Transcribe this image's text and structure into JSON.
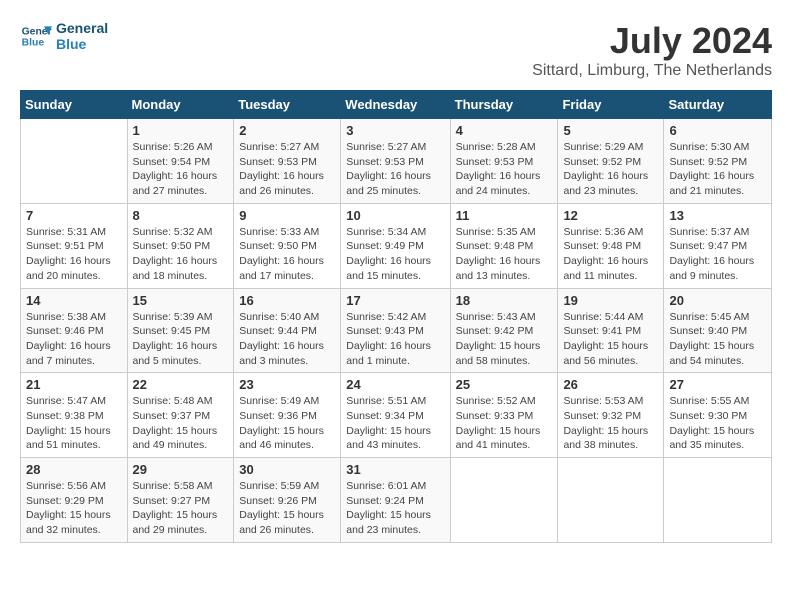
{
  "logo": {
    "line1": "General",
    "line2": "Blue"
  },
  "title": "July 2024",
  "location": "Sittard, Limburg, The Netherlands",
  "days_of_week": [
    "Sunday",
    "Monday",
    "Tuesday",
    "Wednesday",
    "Thursday",
    "Friday",
    "Saturday"
  ],
  "weeks": [
    [
      {
        "day": "",
        "info": ""
      },
      {
        "day": "1",
        "info": "Sunrise: 5:26 AM\nSunset: 9:54 PM\nDaylight: 16 hours\nand 27 minutes."
      },
      {
        "day": "2",
        "info": "Sunrise: 5:27 AM\nSunset: 9:53 PM\nDaylight: 16 hours\nand 26 minutes."
      },
      {
        "day": "3",
        "info": "Sunrise: 5:27 AM\nSunset: 9:53 PM\nDaylight: 16 hours\nand 25 minutes."
      },
      {
        "day": "4",
        "info": "Sunrise: 5:28 AM\nSunset: 9:53 PM\nDaylight: 16 hours\nand 24 minutes."
      },
      {
        "day": "5",
        "info": "Sunrise: 5:29 AM\nSunset: 9:52 PM\nDaylight: 16 hours\nand 23 minutes."
      },
      {
        "day": "6",
        "info": "Sunrise: 5:30 AM\nSunset: 9:52 PM\nDaylight: 16 hours\nand 21 minutes."
      }
    ],
    [
      {
        "day": "7",
        "info": "Sunrise: 5:31 AM\nSunset: 9:51 PM\nDaylight: 16 hours\nand 20 minutes."
      },
      {
        "day": "8",
        "info": "Sunrise: 5:32 AM\nSunset: 9:50 PM\nDaylight: 16 hours\nand 18 minutes."
      },
      {
        "day": "9",
        "info": "Sunrise: 5:33 AM\nSunset: 9:50 PM\nDaylight: 16 hours\nand 17 minutes."
      },
      {
        "day": "10",
        "info": "Sunrise: 5:34 AM\nSunset: 9:49 PM\nDaylight: 16 hours\nand 15 minutes."
      },
      {
        "day": "11",
        "info": "Sunrise: 5:35 AM\nSunset: 9:48 PM\nDaylight: 16 hours\nand 13 minutes."
      },
      {
        "day": "12",
        "info": "Sunrise: 5:36 AM\nSunset: 9:48 PM\nDaylight: 16 hours\nand 11 minutes."
      },
      {
        "day": "13",
        "info": "Sunrise: 5:37 AM\nSunset: 9:47 PM\nDaylight: 16 hours\nand 9 minutes."
      }
    ],
    [
      {
        "day": "14",
        "info": "Sunrise: 5:38 AM\nSunset: 9:46 PM\nDaylight: 16 hours\nand 7 minutes."
      },
      {
        "day": "15",
        "info": "Sunrise: 5:39 AM\nSunset: 9:45 PM\nDaylight: 16 hours\nand 5 minutes."
      },
      {
        "day": "16",
        "info": "Sunrise: 5:40 AM\nSunset: 9:44 PM\nDaylight: 16 hours\nand 3 minutes."
      },
      {
        "day": "17",
        "info": "Sunrise: 5:42 AM\nSunset: 9:43 PM\nDaylight: 16 hours\nand 1 minute."
      },
      {
        "day": "18",
        "info": "Sunrise: 5:43 AM\nSunset: 9:42 PM\nDaylight: 15 hours\nand 58 minutes."
      },
      {
        "day": "19",
        "info": "Sunrise: 5:44 AM\nSunset: 9:41 PM\nDaylight: 15 hours\nand 56 minutes."
      },
      {
        "day": "20",
        "info": "Sunrise: 5:45 AM\nSunset: 9:40 PM\nDaylight: 15 hours\nand 54 minutes."
      }
    ],
    [
      {
        "day": "21",
        "info": "Sunrise: 5:47 AM\nSunset: 9:38 PM\nDaylight: 15 hours\nand 51 minutes."
      },
      {
        "day": "22",
        "info": "Sunrise: 5:48 AM\nSunset: 9:37 PM\nDaylight: 15 hours\nand 49 minutes."
      },
      {
        "day": "23",
        "info": "Sunrise: 5:49 AM\nSunset: 9:36 PM\nDaylight: 15 hours\nand 46 minutes."
      },
      {
        "day": "24",
        "info": "Sunrise: 5:51 AM\nSunset: 9:34 PM\nDaylight: 15 hours\nand 43 minutes."
      },
      {
        "day": "25",
        "info": "Sunrise: 5:52 AM\nSunset: 9:33 PM\nDaylight: 15 hours\nand 41 minutes."
      },
      {
        "day": "26",
        "info": "Sunrise: 5:53 AM\nSunset: 9:32 PM\nDaylight: 15 hours\nand 38 minutes."
      },
      {
        "day": "27",
        "info": "Sunrise: 5:55 AM\nSunset: 9:30 PM\nDaylight: 15 hours\nand 35 minutes."
      }
    ],
    [
      {
        "day": "28",
        "info": "Sunrise: 5:56 AM\nSunset: 9:29 PM\nDaylight: 15 hours\nand 32 minutes."
      },
      {
        "day": "29",
        "info": "Sunrise: 5:58 AM\nSunset: 9:27 PM\nDaylight: 15 hours\nand 29 minutes."
      },
      {
        "day": "30",
        "info": "Sunrise: 5:59 AM\nSunset: 9:26 PM\nDaylight: 15 hours\nand 26 minutes."
      },
      {
        "day": "31",
        "info": "Sunrise: 6:01 AM\nSunset: 9:24 PM\nDaylight: 15 hours\nand 23 minutes."
      },
      {
        "day": "",
        "info": ""
      },
      {
        "day": "",
        "info": ""
      },
      {
        "day": "",
        "info": ""
      }
    ]
  ]
}
